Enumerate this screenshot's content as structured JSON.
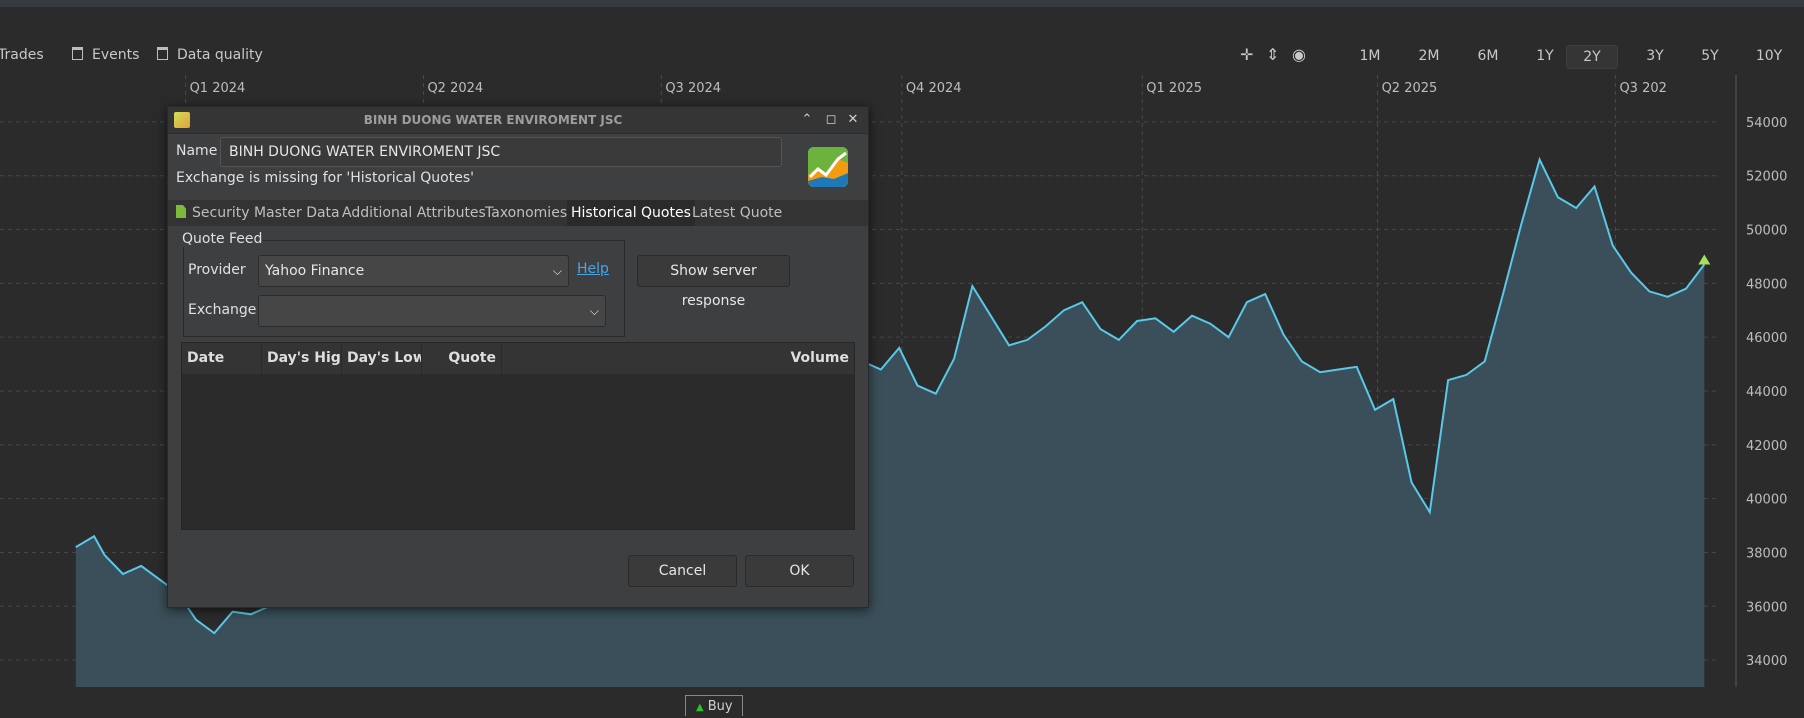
{
  "toolbar": {
    "items": [
      {
        "label": "Trades"
      },
      {
        "label": "Events"
      },
      {
        "label": "Data quality"
      }
    ],
    "ranges": [
      "1M",
      "2M",
      "6M",
      "1Y",
      "2Y",
      "3Y",
      "5Y",
      "10Y"
    ],
    "selected_range": "2Y"
  },
  "chart": {
    "quarters": [
      "Q1 2024",
      "Q2 2024",
      "Q3 2024",
      "Q4 2024",
      "Q1 2025",
      "Q2 2025",
      "Q3 202"
    ],
    "y_ticks": [
      "54000",
      "52000",
      "50000",
      "48000",
      "46000",
      "44000",
      "42000",
      "40000",
      "38000",
      "36000",
      "34000"
    ],
    "colors": {
      "line": "#5ac8e8",
      "fill": "#3a4f59",
      "background": "#2b2b2b",
      "marker": "#a6e05a"
    },
    "marker": "Buy"
  },
  "chart_data": {
    "type": "area",
    "y_range": [
      33000,
      55000
    ],
    "y_ticks": [
      54000,
      52000,
      50000,
      48000,
      46000,
      44000,
      42000,
      40000,
      38000,
      36000,
      34000
    ],
    "x_labels": [
      "Q1 2024",
      "Q2 2024",
      "Q3 2024",
      "Q4 2024",
      "Q1 2025",
      "Q2 2025",
      "Q3 202"
    ],
    "x": [
      "2023-11-20",
      "2023-11-27",
      "2023-12-01",
      "2023-12-08",
      "2023-12-15",
      "2023-12-22",
      "2023-12-29",
      "2024-01-05",
      "2024-01-12",
      "2024-01-19",
      "2024-01-26",
      "2024-02-02",
      "2024-02-09",
      "2024-07-15",
      "2024-07-22",
      "2024-07-29",
      "2024-08-05",
      "2024-08-12",
      "2024-08-19",
      "2024-08-26",
      "2024-09-02",
      "2024-09-09",
      "2024-09-16",
      "2024-09-23",
      "2024-09-30",
      "2024-10-07",
      "2024-10-14",
      "2024-10-21",
      "2024-10-28",
      "2024-11-04",
      "2024-11-11",
      "2024-11-18",
      "2024-11-25",
      "2024-12-02",
      "2024-12-09",
      "2024-12-16",
      "2024-12-23",
      "2024-12-30",
      "2025-01-06",
      "2025-01-13",
      "2025-01-20",
      "2025-01-27",
      "2025-02-03",
      "2025-02-10",
      "2025-02-17",
      "2025-02-24",
      "2025-03-03",
      "2025-03-10",
      "2025-03-17",
      "2025-03-24",
      "2025-03-31",
      "2025-04-07",
      "2025-04-14",
      "2025-04-21",
      "2025-04-28",
      "2025-05-05",
      "2025-05-12",
      "2025-05-19",
      "2025-05-26",
      "2025-06-02",
      "2025-06-09",
      "2025-06-16",
      "2025-06-23",
      "2025-06-30",
      "2025-07-07",
      "2025-07-14",
      "2025-07-21",
      "2025-07-28",
      "2025-08-04"
    ],
    "series": [
      {
        "values": [
          38200,
          38600,
          37900,
          37200,
          37500,
          37000,
          36500,
          35500,
          35000,
          35800,
          35700,
          36000,
          36500,
          45200,
          46500,
          47800,
          46500,
          45200,
          44900,
          45800,
          45000,
          44400,
          45100,
          44800,
          45600,
          44200,
          43900,
          45200,
          47900,
          46800,
          45700,
          45900,
          46400,
          47000,
          47300,
          46300,
          45900,
          46600,
          46700,
          46200,
          46800,
          46500,
          46000,
          47300,
          47600,
          46100,
          45100,
          44700,
          44800,
          44900,
          43300,
          43700,
          40600,
          39500,
          44400,
          44600,
          45100,
          47600,
          50200,
          52600,
          51200,
          50800,
          51600,
          49400,
          48400,
          47700,
          47500,
          47800,
          48700
        ]
      }
    ]
  },
  "dialog": {
    "title": "BINH DUONG WATER ENVIROMENT JSC",
    "name_label": "Name",
    "name_value": "BINH DUONG WATER ENVIROMENT JSC",
    "warning": "Exchange is missing for 'Historical Quotes'",
    "tabs": [
      "Security Master Data",
      "Additional Attributes",
      "Taxonomies",
      "Historical Quotes",
      "Latest Quote"
    ],
    "active_tab": "Historical Quotes",
    "quote_feed": {
      "title": "Quote Feed",
      "provider_label": "Provider",
      "provider_value": "Yahoo Finance",
      "help": "Help",
      "exchange_label": "Exchange",
      "exchange_value": ""
    },
    "server_button": "Show server response",
    "table_columns": [
      "Date",
      "Day's High",
      "Day's Low",
      "Quote",
      "Volume"
    ],
    "cancel": "Cancel",
    "ok": "OK"
  }
}
